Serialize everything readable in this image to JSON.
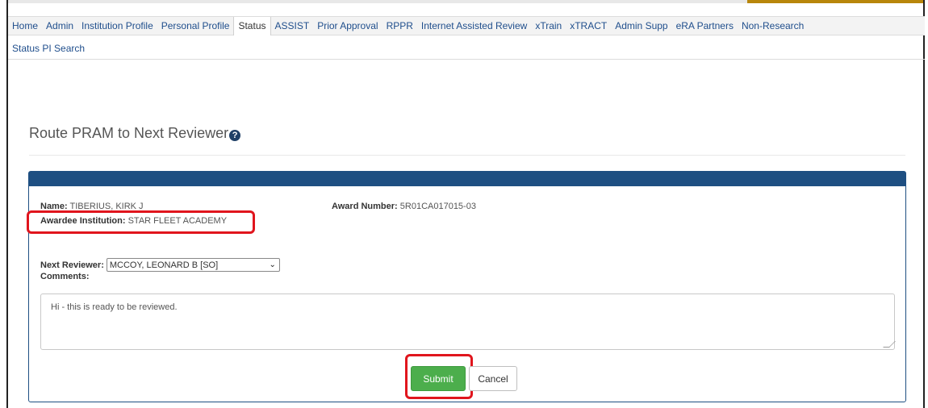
{
  "nav": {
    "tabs": [
      {
        "label": "Home"
      },
      {
        "label": "Admin"
      },
      {
        "label": "Institution Profile"
      },
      {
        "label": "Personal Profile"
      },
      {
        "label": "Status"
      },
      {
        "label": "ASSIST"
      },
      {
        "label": "Prior Approval"
      },
      {
        "label": "RPPR"
      },
      {
        "label": "Internet Assisted Review"
      },
      {
        "label": "xTrain"
      },
      {
        "label": "xTRACT"
      },
      {
        "label": "Admin Supp"
      },
      {
        "label": "eRA Partners"
      },
      {
        "label": "Non-Research"
      }
    ],
    "active_tab": "Status",
    "subnav": "Status PI Search"
  },
  "page": {
    "title": "Route PRAM to Next Reviewer",
    "help_icon": "?"
  },
  "form": {
    "name_label": "Name:",
    "name_value": "TIBERIUS, KIRK J",
    "award_label": "Award Number:",
    "award_value": "5R01CA017015-03",
    "institution_label": "Awardee Institution:",
    "institution_value": "STAR FLEET ACADEMY",
    "reviewer_label": "Next Reviewer:",
    "reviewer_value": "MCCOY, LEONARD B [SO]",
    "comments_label": "Comments:",
    "comments_value": "Hi - this is ready to be reviewed.",
    "submit_label": "Submit",
    "cancel_label": "Cancel"
  },
  "colors": {
    "panel_header": "#1e4f82",
    "submit": "#4cae4c",
    "highlight": "#e0151d"
  }
}
